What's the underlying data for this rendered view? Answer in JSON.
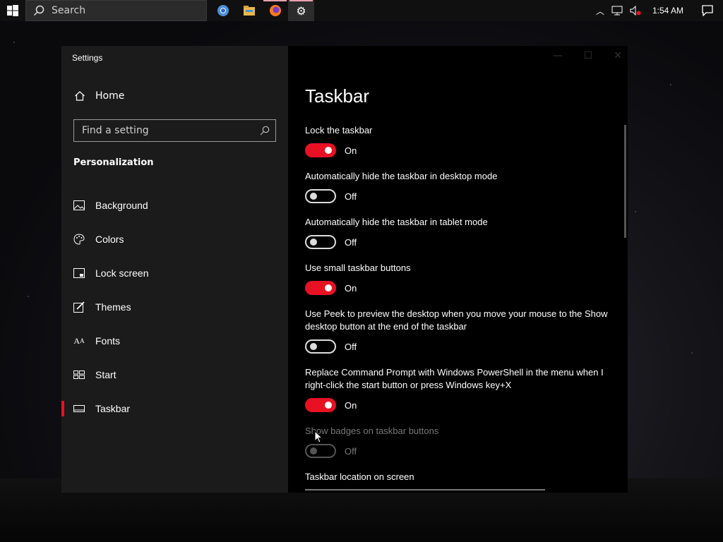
{
  "taskbar": {
    "search_placeholder": "Search",
    "apps": [
      {
        "name": "chrome-icon"
      },
      {
        "name": "file-explorer-icon"
      },
      {
        "name": "firefox-icon"
      },
      {
        "name": "settings-gear-icon"
      }
    ],
    "clock": "1:54 AM"
  },
  "window": {
    "title": "Settings",
    "sidebar": {
      "home_label": "Home",
      "find_placeholder": "Find a setting",
      "section_label": "Personalization",
      "items": [
        {
          "label": "Background",
          "icon": "image-icon"
        },
        {
          "label": "Colors",
          "icon": "palette-icon"
        },
        {
          "label": "Lock screen",
          "icon": "lock-screen-icon"
        },
        {
          "label": "Themes",
          "icon": "brush-icon"
        },
        {
          "label": "Fonts",
          "icon": "font-icon"
        },
        {
          "label": "Start",
          "icon": "start-icon"
        },
        {
          "label": "Taskbar",
          "icon": "taskbar-icon"
        }
      ],
      "selected": "Taskbar"
    },
    "main": {
      "page_title": "Taskbar",
      "settings": [
        {
          "label": "Lock the taskbar",
          "state": "On"
        },
        {
          "label": "Automatically hide the taskbar in desktop mode",
          "state": "Off"
        },
        {
          "label": "Automatically hide the taskbar in tablet mode",
          "state": "Off"
        },
        {
          "label": "Use small taskbar buttons",
          "state": "On"
        },
        {
          "label": "Use Peek to preview the desktop when you move your mouse to the Show desktop button at the end of the taskbar",
          "state": "Off"
        },
        {
          "label": "Replace Command Prompt with Windows PowerShell in the menu when I right-click the start button or press Windows key+X",
          "state": "On"
        },
        {
          "label": "Show badges on taskbar buttons",
          "state": "Off",
          "disabled": true
        }
      ],
      "location_label": "Taskbar location on screen"
    }
  },
  "colors": {
    "accent": "#e81123",
    "sidebar_bg": "#1b1b1b",
    "main_bg": "#000000"
  }
}
